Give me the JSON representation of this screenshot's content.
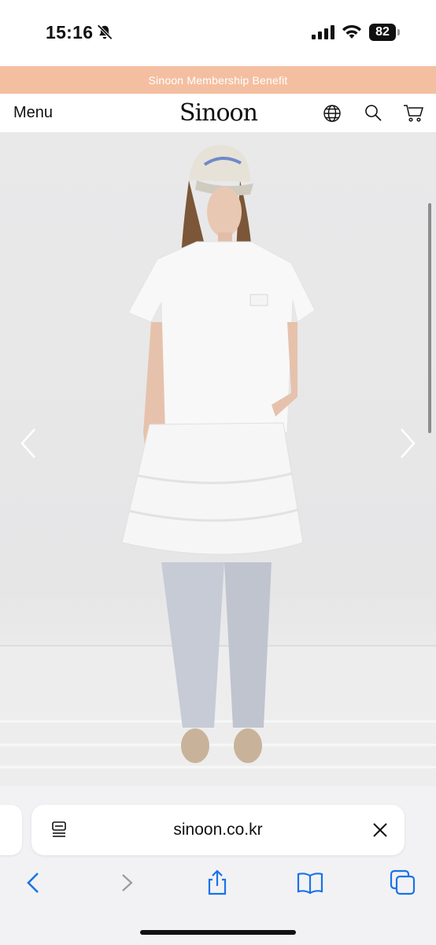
{
  "status_bar": {
    "time": "15:16",
    "battery_percent": "82",
    "icons": [
      "bell-slash-icon",
      "cellular-signal-icon",
      "wifi-icon",
      "battery-icon"
    ]
  },
  "banner": {
    "text": "Sinoon Membership Benefit",
    "background_color": "#f4bfa1"
  },
  "header": {
    "menu_label": "Menu",
    "logo_text": "Sinoon",
    "icons": [
      "globe-icon",
      "search-icon",
      "cart-icon"
    ]
  },
  "hero": {
    "controls": [
      "chevron-left-icon",
      "chevron-right-icon"
    ]
  },
  "browser": {
    "url": "sinoon.co.kr",
    "address_icons": [
      "reader-icon",
      "clear-icon"
    ],
    "toolbar": [
      "back-icon",
      "forward-icon",
      "share-icon",
      "bookmarks-icon",
      "tabs-icon"
    ],
    "accent_color": "#1a73e8"
  }
}
